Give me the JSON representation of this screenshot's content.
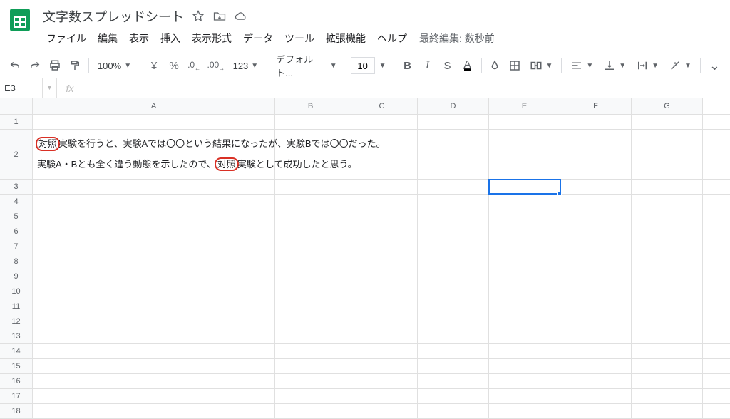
{
  "doc": {
    "title": "文字数スプレッドシート"
  },
  "titleIcons": {
    "star": "star",
    "move": "move",
    "cloud": "cloud"
  },
  "menu": {
    "items": [
      "ファイル",
      "編集",
      "表示",
      "挿入",
      "表示形式",
      "データ",
      "ツール",
      "拡張機能",
      "ヘルプ"
    ],
    "lastEdit": "最終編集: 数秒前"
  },
  "toolbar": {
    "zoom": "100%",
    "currency": "¥",
    "percent": "%",
    "decDec": ".0",
    "incDec": ".00",
    "numFmt": "123",
    "font": "デフォルト...",
    "fontSize": "10"
  },
  "nameBox": "E3",
  "fxValue": "",
  "columns": [
    "A",
    "B",
    "C",
    "D",
    "E",
    "F",
    "G"
  ],
  "rowCount": 18,
  "activeCell": {
    "row": 3,
    "col": 5
  },
  "cellA2": {
    "prefix1": "",
    "hl1": "対照",
    "mid1": "実験を行うと、実験Aでは〇〇という結果になったが、実験Bでは〇〇だった。",
    "line2a": "実験A・Bとも全く違う動態を示したので、",
    "hl2": "対照",
    "line2b": "実験として成功したと思う。"
  }
}
